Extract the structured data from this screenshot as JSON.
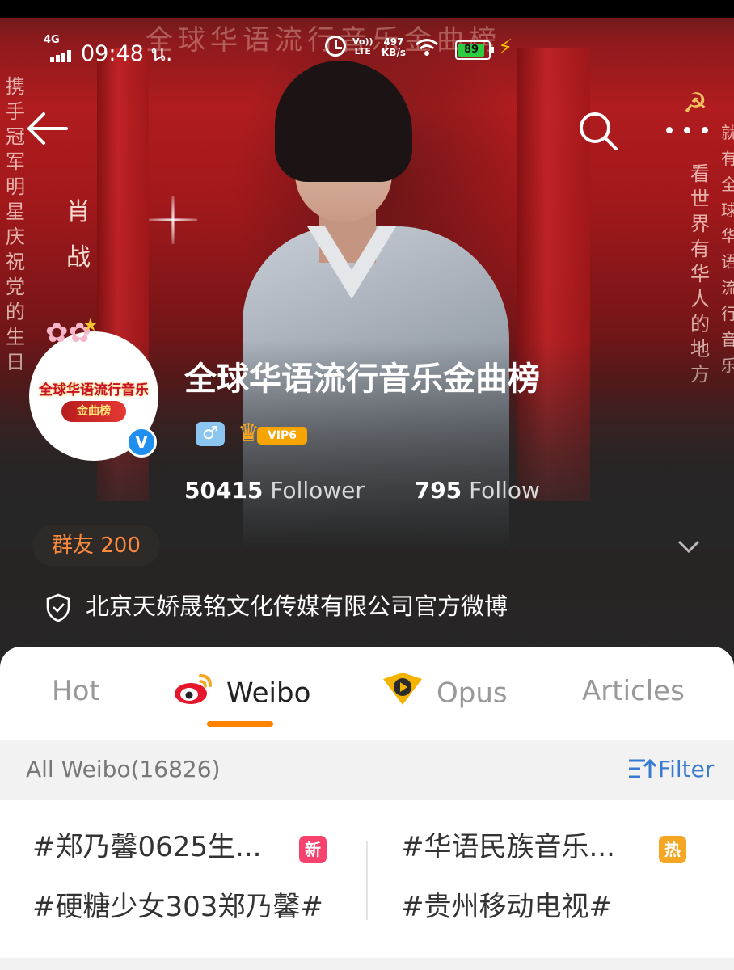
{
  "status_bar": {
    "network": "4G",
    "time": "09:48 น.",
    "lte_top": "Vo))",
    "lte_bottom": "LTE",
    "speed_value": "497",
    "speed_unit": "KB/s",
    "battery": "89"
  },
  "hero": {
    "banner_text": "全球华语流行音乐金曲榜",
    "left_vertical_text": "携手冠军明星庆祝党的生日",
    "name_vertical_text": "肖战",
    "right_vertical_text_1": "看世界有华人的地方",
    "right_vertical_text_2": "就有全球华语流行音乐"
  },
  "profile": {
    "avatar_text_top": "全球华语流行音乐",
    "avatar_text_bottom": "金曲榜",
    "name": "全球华语流行音乐金曲榜",
    "gender_symbol": "♂",
    "vip_label": "VIP6",
    "follower_count": "50415",
    "follower_label": "Follower",
    "follow_count": "795",
    "follow_label": "Follow",
    "group_label": "群友 200",
    "organization": "北京天娇晟铭文化传媒有限公司官方微博"
  },
  "tabs": {
    "items": [
      {
        "label": "Hot",
        "active": false
      },
      {
        "label": "Weibo",
        "active": true
      },
      {
        "label": "Opus",
        "active": false
      },
      {
        "label": "Articles",
        "active": false
      }
    ]
  },
  "filter_bar": {
    "all_weibo": "All Weibo(16826)",
    "filter_label": "Filter"
  },
  "topics": {
    "items": [
      {
        "text": "#郑乃馨0625生...",
        "badge": "新"
      },
      {
        "text": "#华语民族音乐...",
        "badge": "热"
      },
      {
        "text": "#硬糖少女303郑乃馨#",
        "badge": ""
      },
      {
        "text": "#贵州移动电视#",
        "badge": ""
      }
    ]
  },
  "colors": {
    "accent_orange": "#ff8200",
    "verified_blue": "#1f8ff0",
    "filter_blue": "#3b7ad1",
    "badge_new": "#f5436e",
    "badge_hot": "#f5a623",
    "group_orange": "#ff8a3d"
  },
  "icons": [
    "back-arrow-icon",
    "search-icon",
    "more-icon",
    "verified-icon",
    "gender-male-icon",
    "vip-crown-icon",
    "chevron-down-icon",
    "shield-icon",
    "weibo-logo-icon",
    "opus-icon",
    "filter-icon",
    "alarm-icon",
    "wifi-icon",
    "battery-icon",
    "charging-bolt-icon"
  ]
}
